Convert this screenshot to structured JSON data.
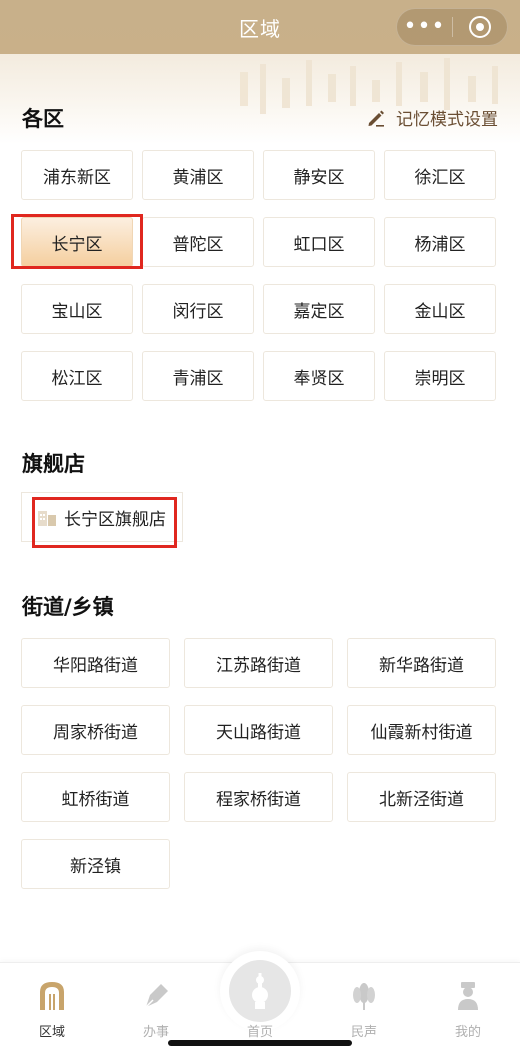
{
  "header": {
    "title": "区域",
    "menu_icon": "more-dots-icon",
    "close_icon": "target-icon"
  },
  "districts": {
    "title": "各区",
    "memory_setting_label": "记忆模式设置",
    "items": [
      "浦东新区",
      "黄浦区",
      "静安区",
      "徐汇区",
      "长宁区",
      "普陀区",
      "虹口区",
      "杨浦区",
      "宝山区",
      "闵行区",
      "嘉定区",
      "金山区",
      "松江区",
      "青浦区",
      "奉贤区",
      "崇明区"
    ],
    "selected": "长宁区"
  },
  "flagship": {
    "title": "旗舰店",
    "items": [
      "长宁区旗舰店"
    ]
  },
  "streets": {
    "title": "街道/乡镇",
    "items": [
      "华阳路街道",
      "江苏路街道",
      "新华路街道",
      "周家桥街道",
      "天山路街道",
      "仙霞新村街道",
      "虹桥街道",
      "程家桥街道",
      "北新泾街道",
      "新泾镇"
    ]
  },
  "tabbar": {
    "items": [
      {
        "label": "区域",
        "icon": "arch-icon",
        "active": true
      },
      {
        "label": "办事",
        "icon": "pen-nib-icon",
        "active": false
      },
      {
        "label": "首页",
        "icon": "pagoda-icon",
        "active": false
      },
      {
        "label": "民声",
        "icon": "flower-icon",
        "active": false
      },
      {
        "label": "我的",
        "icon": "person-icon",
        "active": false
      }
    ]
  },
  "colors": {
    "accent": "#c8b08a",
    "highlight": "#e0271f",
    "selected_fill": "#f5cf9f"
  }
}
